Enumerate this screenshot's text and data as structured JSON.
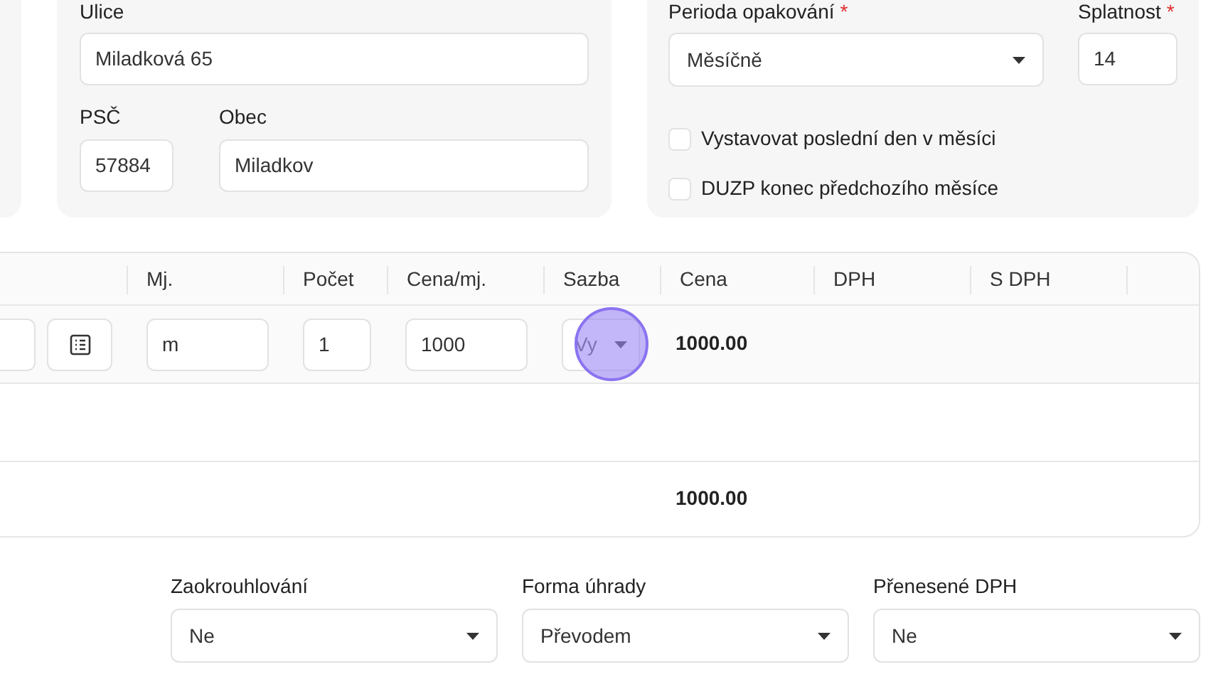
{
  "address": {
    "street_label": "Ulice",
    "street": "Miladková 65",
    "zip_label": "PSČ",
    "zip": "57884",
    "city_label": "Obec",
    "city": "Miladkov"
  },
  "recurrence": {
    "period_label": "Perioda opakování",
    "period_mark": "*",
    "period": "Měsíčně",
    "due_label": "Splatnost",
    "due_mark": "*",
    "due": "14",
    "options": [
      {
        "label": "Vystavovat poslední den v měsíci",
        "checked": false
      },
      {
        "label": "DUZP konec předchozího měsíce",
        "checked": false
      }
    ]
  },
  "items_table": {
    "columns": [
      "Mj.",
      "Počet",
      "Cena/mj.",
      "Sazba",
      "Cena",
      "DPH",
      "S DPH"
    ],
    "rows": [
      {
        "unit": "m",
        "quantity": "1",
        "unit_price": "1000",
        "rate": "Vy",
        "price": "1000.00"
      }
    ],
    "total": "1000.00"
  },
  "footer_fields": [
    {
      "label": "Zaokrouhlování",
      "value": "Ne"
    },
    {
      "label": "Forma úhrady",
      "value": "Převodem"
    },
    {
      "label": "Přenesené DPH",
      "value": "Ne"
    }
  ]
}
